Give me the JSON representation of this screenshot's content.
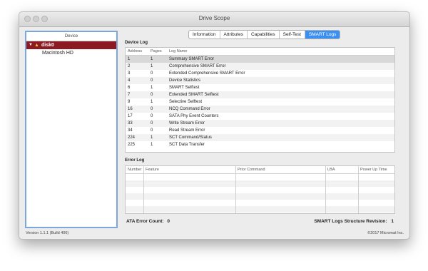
{
  "window": {
    "title": "Drive Scope"
  },
  "device_panel": {
    "header": "Device",
    "disk_label": "disk0",
    "volume_label": "Macintosh HD"
  },
  "tabs": [
    {
      "label": "Information",
      "active": false
    },
    {
      "label": "Attributes",
      "active": false
    },
    {
      "label": "Capabilities",
      "active": false
    },
    {
      "label": "Self-Test",
      "active": false
    },
    {
      "label": "SMART Logs",
      "active": true
    }
  ],
  "device_log": {
    "title": "Device Log",
    "columns": [
      "Address",
      "Pages",
      "Log Name"
    ],
    "rows": [
      {
        "address": "1",
        "pages": "1",
        "name": "Summary SMART Error"
      },
      {
        "address": "2",
        "pages": "1",
        "name": "Comprehensive SMART Error"
      },
      {
        "address": "3",
        "pages": "0",
        "name": "Extended Comprehensive SMART Error"
      },
      {
        "address": "4",
        "pages": "0",
        "name": "Device Statistics"
      },
      {
        "address": "6",
        "pages": "1",
        "name": "SMART Selftest"
      },
      {
        "address": "7",
        "pages": "0",
        "name": "Extended SMART Selftest"
      },
      {
        "address": "9",
        "pages": "1",
        "name": "Selective Selftest"
      },
      {
        "address": "16",
        "pages": "0",
        "name": "NCQ Command Error"
      },
      {
        "address": "17",
        "pages": "0",
        "name": "SATA Phy Event Counters"
      },
      {
        "address": "33",
        "pages": "0",
        "name": "Write Stream Error"
      },
      {
        "address": "34",
        "pages": "0",
        "name": "Read Stream Error"
      },
      {
        "address": "224",
        "pages": "1",
        "name": "SCT Command/Status"
      },
      {
        "address": "225",
        "pages": "1",
        "name": "SCT Data Transfer"
      }
    ]
  },
  "error_log": {
    "title": "Error Log",
    "columns": [
      "Number",
      "Feature",
      "Prior Command",
      "LBA",
      "Power Up Time"
    ]
  },
  "summary": {
    "ata_error_count_label": "ATA Error Count:",
    "ata_error_count": "0",
    "structure_revision_label": "SMART Logs Structure Revision:",
    "structure_revision": "1"
  },
  "status_bar": {
    "version": "Version 1.1.1 (Build 406)",
    "copyright": "©2017 Micromat Inc."
  }
}
